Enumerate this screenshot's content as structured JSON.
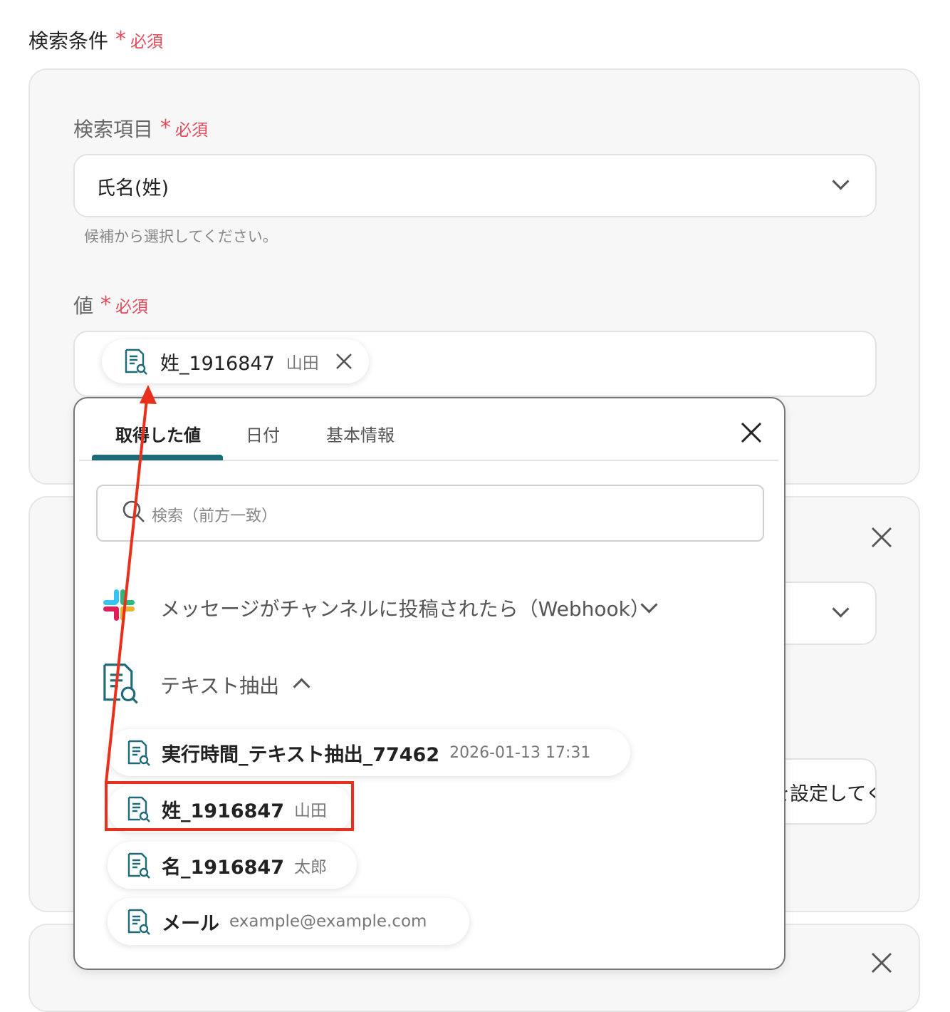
{
  "section": {
    "title": "検索条件",
    "required": "必須"
  },
  "search_field": {
    "label": "検索項目",
    "required": "必須",
    "selected_value": "氏名(姓)",
    "helper": "候補から選択してください。"
  },
  "value_field": {
    "label": "値",
    "required": "必須",
    "chip": {
      "name": "姓_1916847",
      "value": "山田"
    }
  },
  "background": {
    "partial_text": "を設定してく"
  },
  "picker": {
    "tabs": [
      "取得した値",
      "日付",
      "基本情報"
    ],
    "active_tab": 0,
    "search_placeholder": "検索（前方一致）",
    "groups": [
      {
        "title": "メッセージがチャンネルに投稿されたら（Webhook）",
        "icon": "slack-icon",
        "expanded": false
      },
      {
        "title": "テキスト抽出",
        "icon": "text-extract-icon",
        "expanded": true
      }
    ],
    "items": [
      {
        "name": "実行時間_テキスト抽出_77462",
        "value": "2026-01-13 17:31"
      },
      {
        "name": "姓_1916847",
        "value": "山田"
      },
      {
        "name": "名_1916847",
        "value": "太郎"
      },
      {
        "name": "メール",
        "value": "example@example.com"
      }
    ]
  },
  "colors": {
    "accent": "#1e6b7a",
    "required": "#e64a5a",
    "annotation": "#e8301c",
    "tab_underline": "#1e6b7a"
  }
}
